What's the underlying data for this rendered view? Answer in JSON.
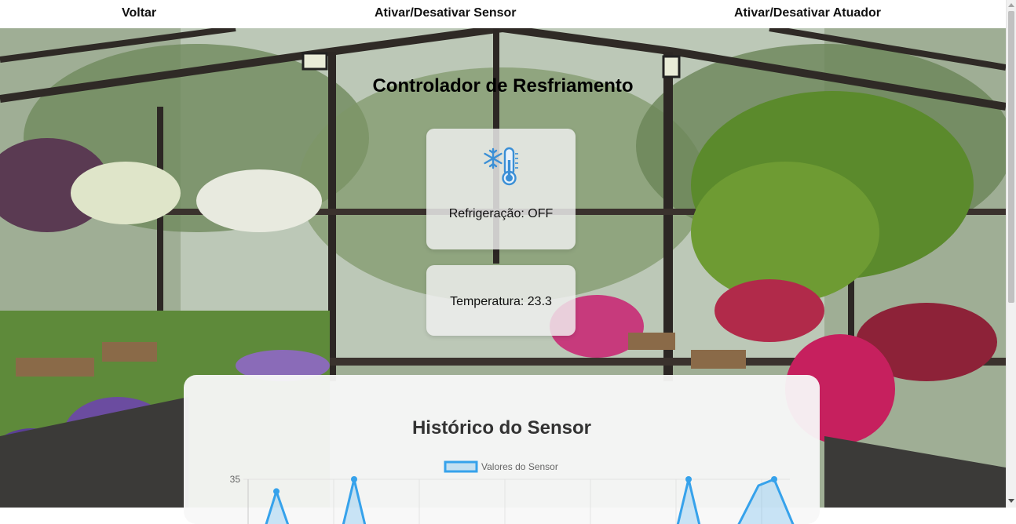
{
  "nav": {
    "back_label": "Voltar",
    "toggle_sensor_label": "Ativar/Desativar Sensor",
    "toggle_actuator_label": "Ativar/Desativar Atuador"
  },
  "page": {
    "title": "Controlador de Resfriamento"
  },
  "status_card": {
    "icon": "snowflake-thermometer-icon",
    "text": "Refrigeração: OFF"
  },
  "temperature_card": {
    "text": "Temperatura: 23.3"
  },
  "history": {
    "title": "Histórico do Sensor"
  },
  "colors": {
    "accent": "#36a2eb",
    "accent_fill": "rgba(54,162,235,0.25)"
  },
  "chart_data": {
    "type": "line",
    "title": "",
    "series": [
      {
        "name": "Valores do Sensor"
      }
    ],
    "y_tick_visible": "35",
    "visible_points_top": [
      {
        "x_index": 0,
        "y": 34
      },
      {
        "x_index": 1,
        "y": 35
      },
      {
        "x_index": 5,
        "y": 35
      },
      {
        "x_index": 6,
        "y": 35
      }
    ],
    "grid": true,
    "legend_position": "top"
  }
}
